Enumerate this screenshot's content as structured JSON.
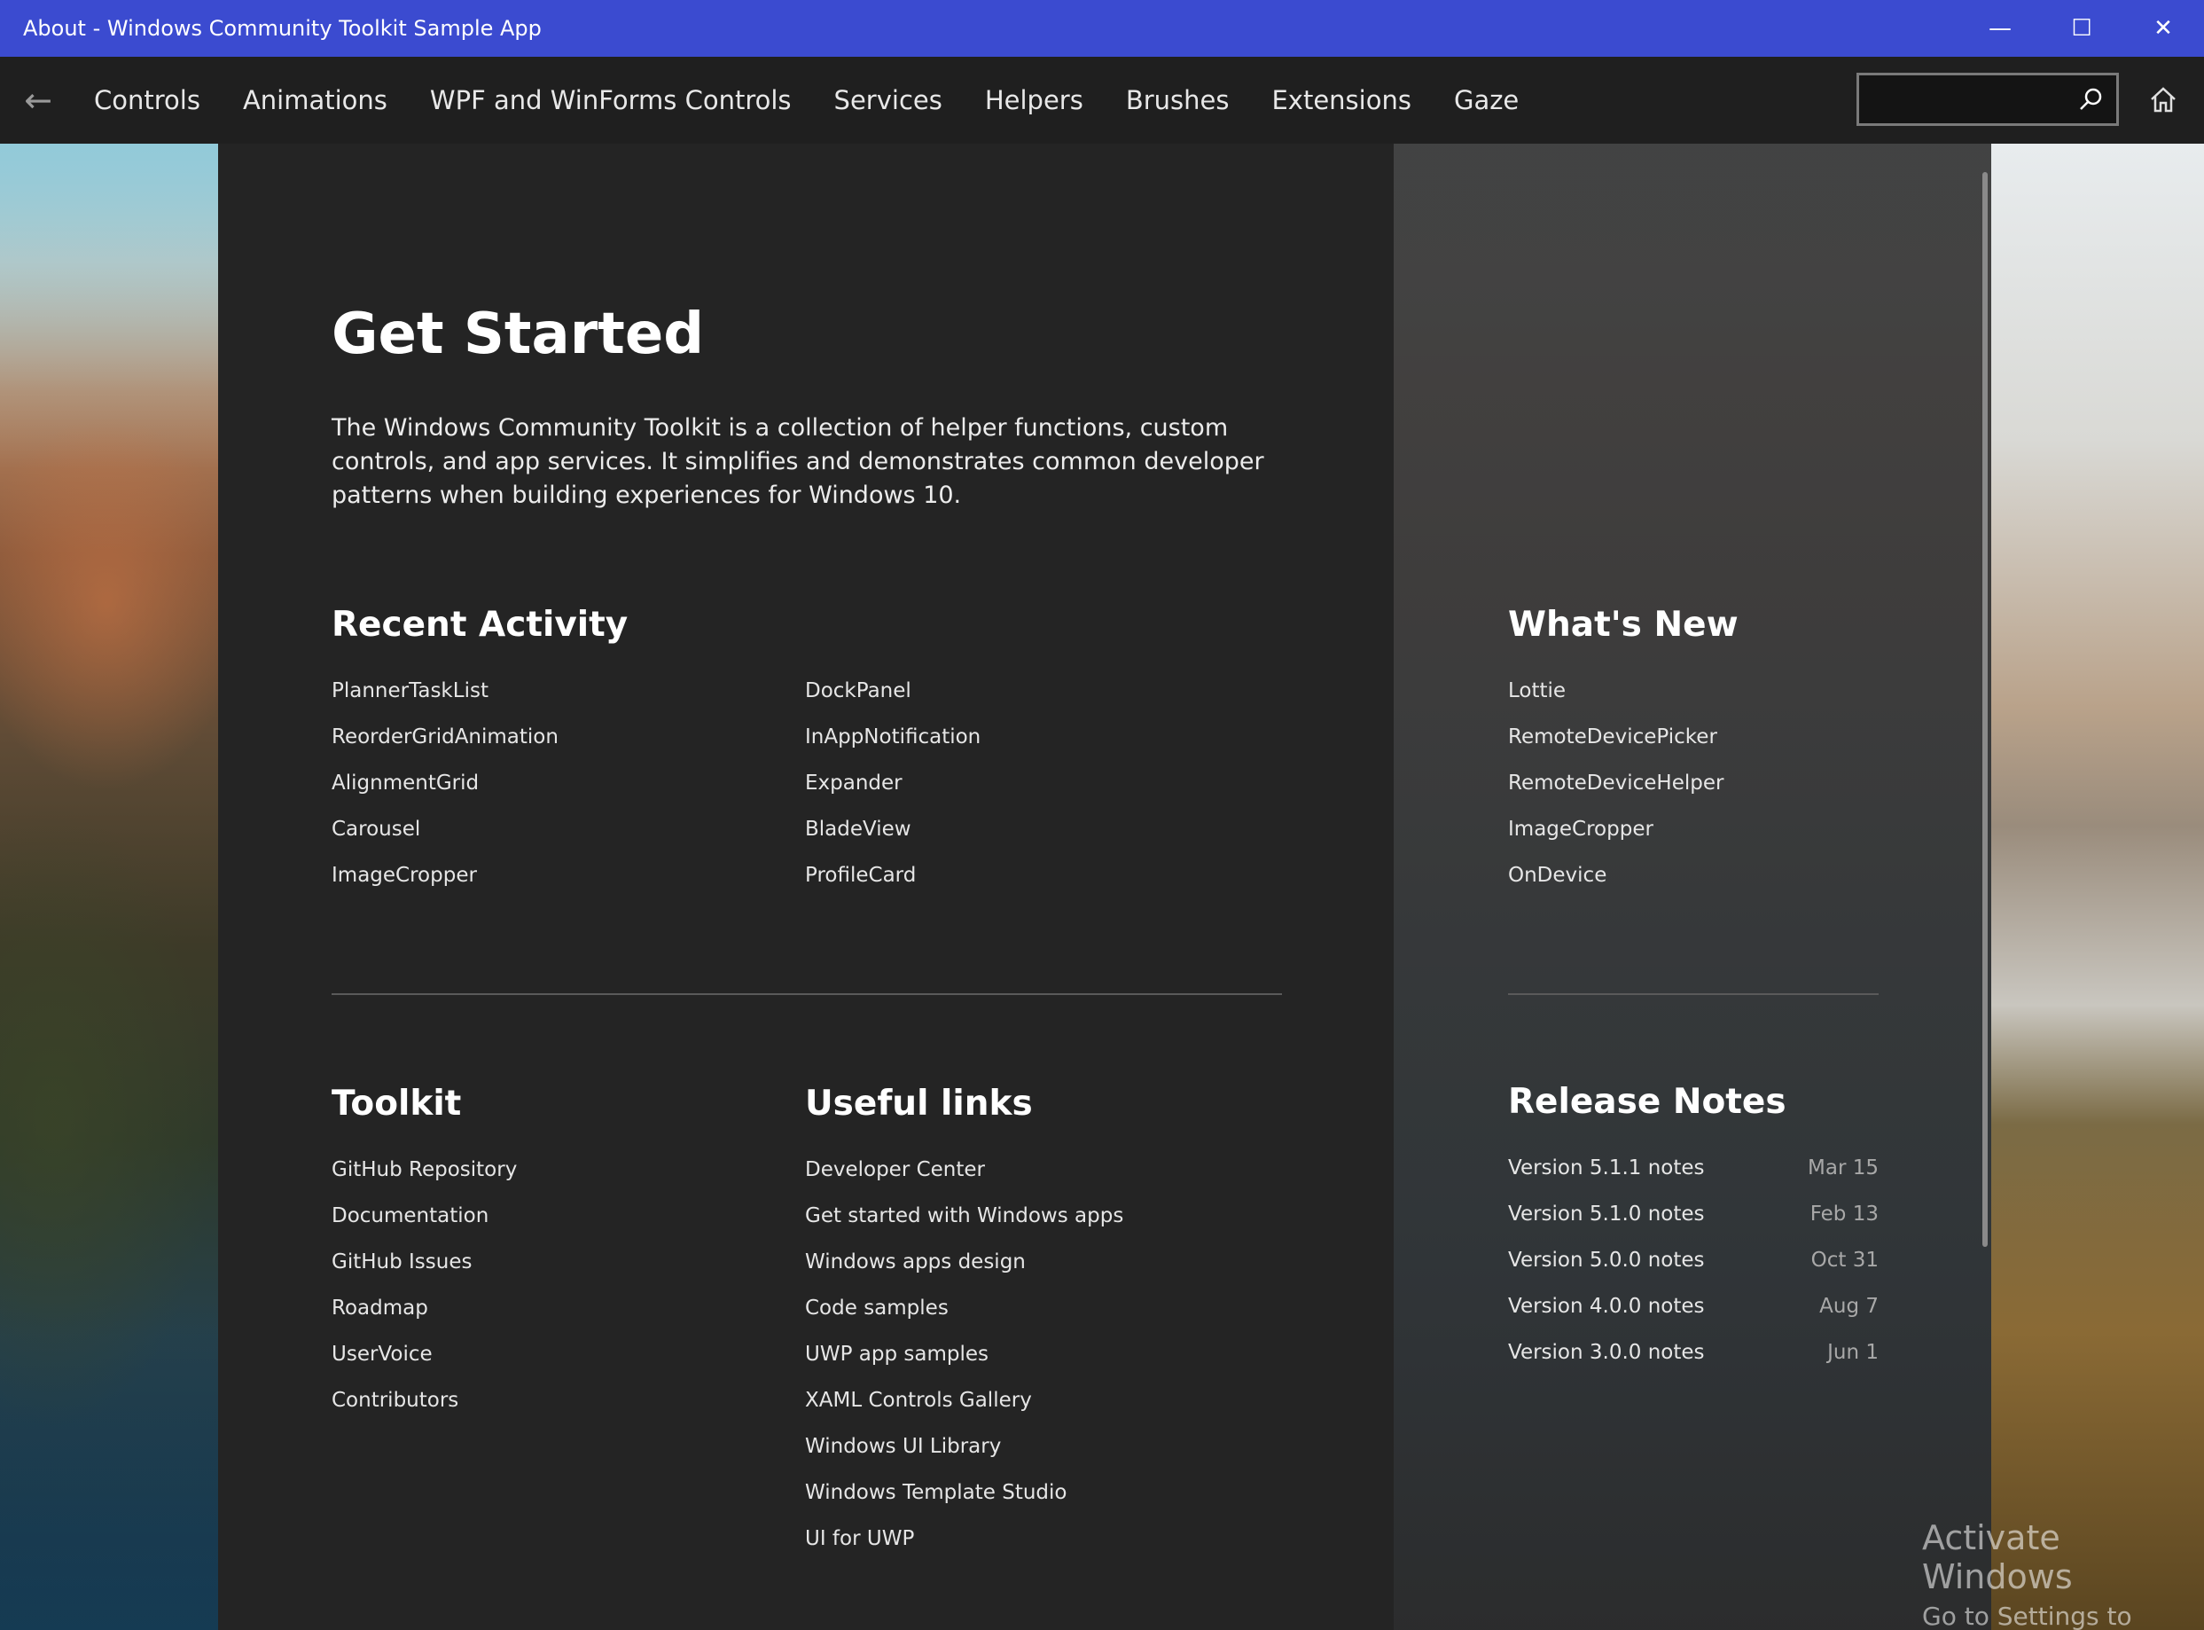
{
  "window": {
    "title": "About - Windows Community Toolkit Sample App",
    "minimize_glyph": "—",
    "maximize_glyph": "☐",
    "close_glyph": "✕"
  },
  "nav": {
    "back_glyph": "←",
    "items": [
      "Controls",
      "Animations",
      "WPF and WinForms Controls",
      "Services",
      "Helpers",
      "Brushes",
      "Extensions",
      "Gaze"
    ],
    "search_placeholder": "",
    "search_value": ""
  },
  "page": {
    "title": "Get Started",
    "intro": "The Windows Community Toolkit is a collection of helper functions, custom controls, and app services. It simplifies and demonstrates common developer patterns when building experiences for Windows 10."
  },
  "recent_activity": {
    "title": "Recent Activity",
    "column1": [
      "PlannerTaskList",
      "ReorderGridAnimation",
      "AlignmentGrid",
      "Carousel",
      "ImageCropper"
    ],
    "column2": [
      "DockPanel",
      "InAppNotification",
      "Expander",
      "BladeView",
      "ProfileCard"
    ]
  },
  "whats_new": {
    "title": "What's New",
    "items": [
      "Lottie",
      "RemoteDevicePicker",
      "RemoteDeviceHelper",
      "ImageCropper",
      "OnDevice"
    ]
  },
  "toolkit": {
    "title": "Toolkit",
    "items": [
      "GitHub Repository",
      "Documentation",
      "GitHub Issues",
      "Roadmap",
      "UserVoice",
      "Contributors"
    ]
  },
  "useful_links": {
    "title": "Useful links",
    "items": [
      "Developer Center",
      "Get started with Windows apps",
      "Windows apps design",
      "Code samples",
      "UWP app samples",
      "XAML Controls Gallery",
      "Windows UI Library",
      "Windows Template Studio",
      "UI for UWP"
    ]
  },
  "release_notes": {
    "title": "Release Notes",
    "items": [
      {
        "label": "Version 5.1.1 notes",
        "date": "Mar 15"
      },
      {
        "label": "Version 5.1.0 notes",
        "date": "Feb 13"
      },
      {
        "label": "Version 5.0.0 notes",
        "date": "Oct 31"
      },
      {
        "label": "Version 4.0.0 notes",
        "date": "Aug 7"
      },
      {
        "label": "Version 3.0.0 notes",
        "date": "Jun 1"
      }
    ]
  },
  "watermark": {
    "line1": "Activate Windows",
    "line2": "Go to Settings to activate"
  },
  "colors": {
    "titlebar": "#3b4bd0",
    "navbar": "#1f1f1f",
    "main_panel": "#242424"
  }
}
